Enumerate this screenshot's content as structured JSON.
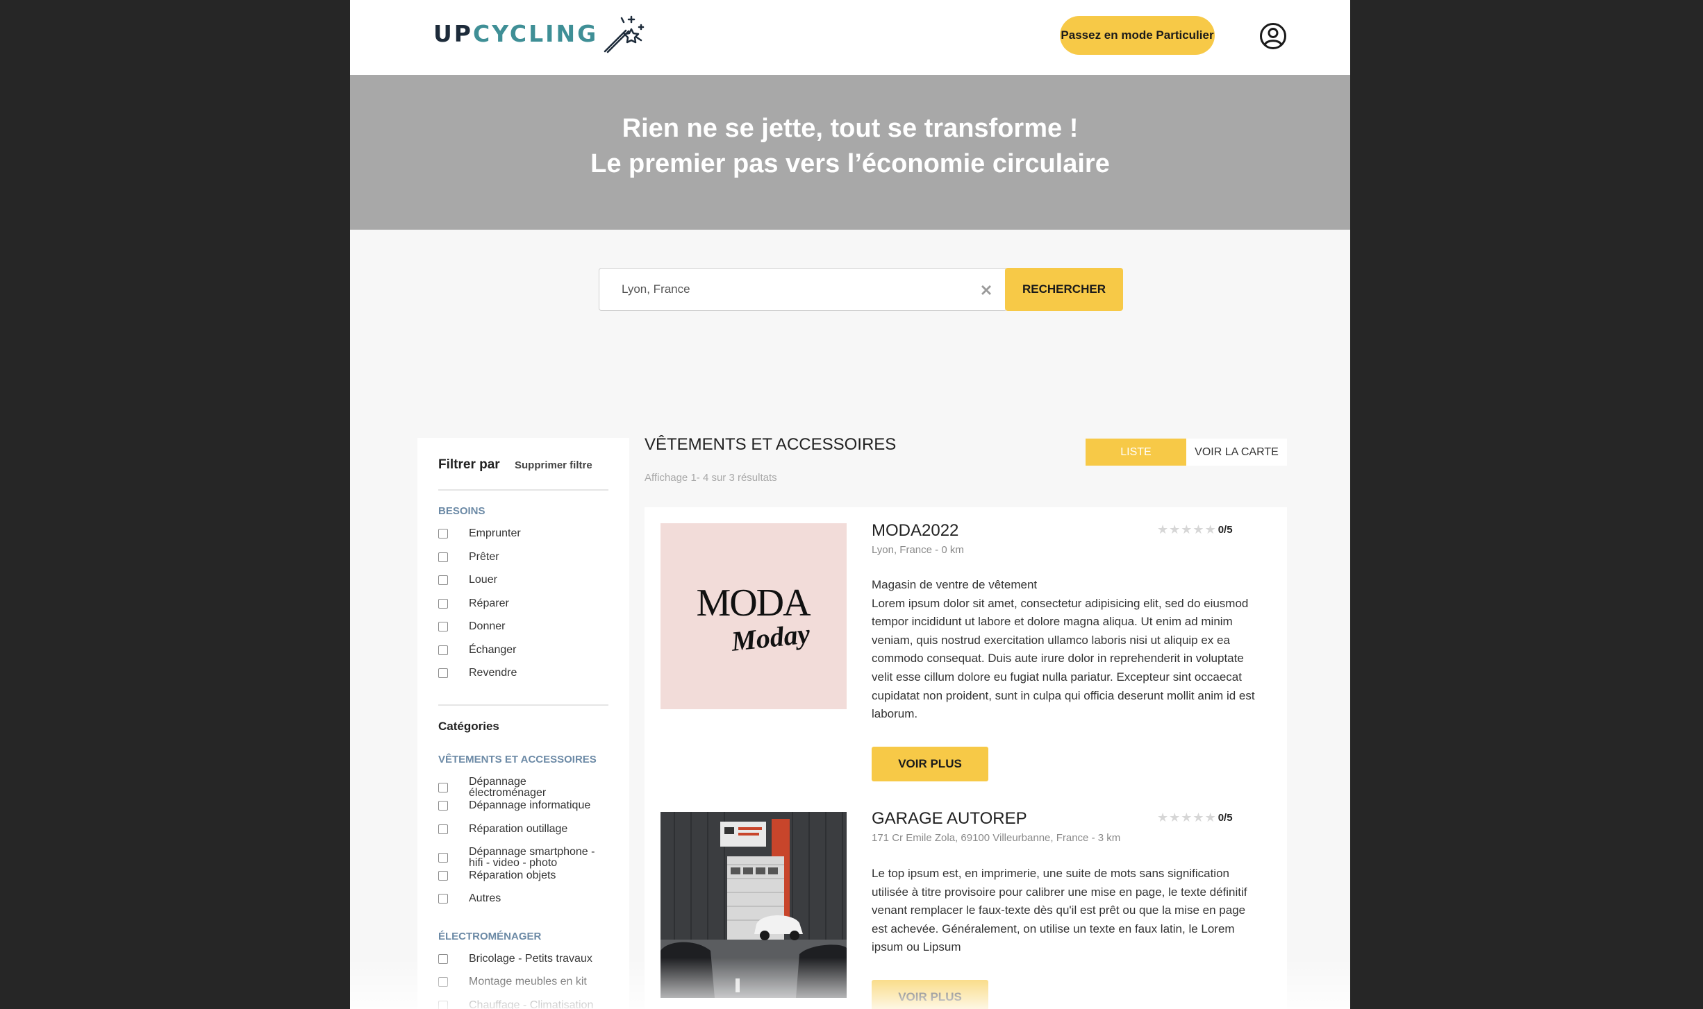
{
  "header": {
    "logo": {
      "part1": "UP",
      "part2": "CYCLING",
      "icon": "magic-wand-icon"
    },
    "mode_button": "Passez en mode Particulier",
    "user_icon": "user-circle-icon"
  },
  "hero": {
    "line1": "Rien ne se jette, tout se transforme !",
    "line2": "Le premier pas vers l’économie circulaire"
  },
  "search": {
    "value": "Lyon, France",
    "clear_icon": "close-x-icon",
    "button": "RECHERCHER"
  },
  "sidebar": {
    "title": "Filtrer par",
    "clear": "Supprimer filtre",
    "besoins_title": "BESOINS",
    "besoins": [
      "Emprunter",
      "Prêter",
      "Louer",
      "Réparer",
      "Donner",
      "Échanger",
      "Revendre"
    ],
    "categories_title": "Catégories",
    "vetements_title": "VÊTEMENTS ET ACCESSOIRES",
    "vetements": [
      {
        "line1": "Dépannage",
        "line2": "électroménager"
      },
      {
        "line1": "Dépannage informatique",
        "line2": ""
      },
      {
        "line1": "Réparation outillage",
        "line2": ""
      },
      {
        "line1": "Dépannage smartphone -",
        "line2": "hifi - video - photo"
      },
      {
        "line1": "Réparation objets",
        "line2": ""
      },
      {
        "line1": "Autres",
        "line2": ""
      }
    ],
    "electro_title": "ÉLECTROMÉNAGER",
    "electro": [
      "Bricolage - Petits travaux",
      "Montage meubles en kit",
      "Chauffage - Climatisation"
    ]
  },
  "results": {
    "title": "VÊTEMENTS ET ACCESSOIRES",
    "count": "Affichage  1- 4 sur 3 résultats",
    "view_list": "LISTE",
    "view_map": "VOIR LA CARTE",
    "cards": [
      {
        "title": "MODA2022",
        "address": "Lyon, France - 0 km",
        "rating": "0/5",
        "rating_value": 0,
        "subtitle": "Magasin de ventre de vêtement",
        "description": "Lorem ipsum dolor sit amet, consectetur adipisicing elit, sed do eiusmod tempor incididunt ut labore et dolore magna aliqua. Ut enim ad minim veniam, quis nostrud exercitation ullamco laboris nisi ut aliquip ex ea commodo consequat. Duis aute irure dolor in reprehenderit in voluptate velit esse cillum dolore eu fugiat nulla pariatur. Excepteur sint occaecat cupidatat non proident, sunt in culpa qui officia deserunt mollit anim id est laborum.",
        "button": "VOIR PLUS",
        "image_text1": "MODA",
        "image_text2": "Moday"
      },
      {
        "title": "GARAGE AUTOREP",
        "address": "171 Cr Emile Zola, 69100 Villeurbanne, France - 3 km",
        "rating": "0/5",
        "rating_value": 0,
        "description": "Le top ipsum est, en imprimerie, une suite de mots sans signification utilisée à titre provisoire pour calibrer une mise en page, le texte définitif venant remplacer le faux-texte dès qu'il est prêt ou que la mise en page est achevée. Généralement, on utilise un texte en faux latin, le Lorem ipsum ou Lipsum",
        "button": "VOIR PLUS"
      }
    ]
  },
  "colors": {
    "accent": "#f7c947",
    "hero_bg": "#a8a8a8",
    "section_title": "#6c8aa6",
    "logo_dark": "#1d2b3a",
    "logo_teal": "#3f8f96"
  }
}
